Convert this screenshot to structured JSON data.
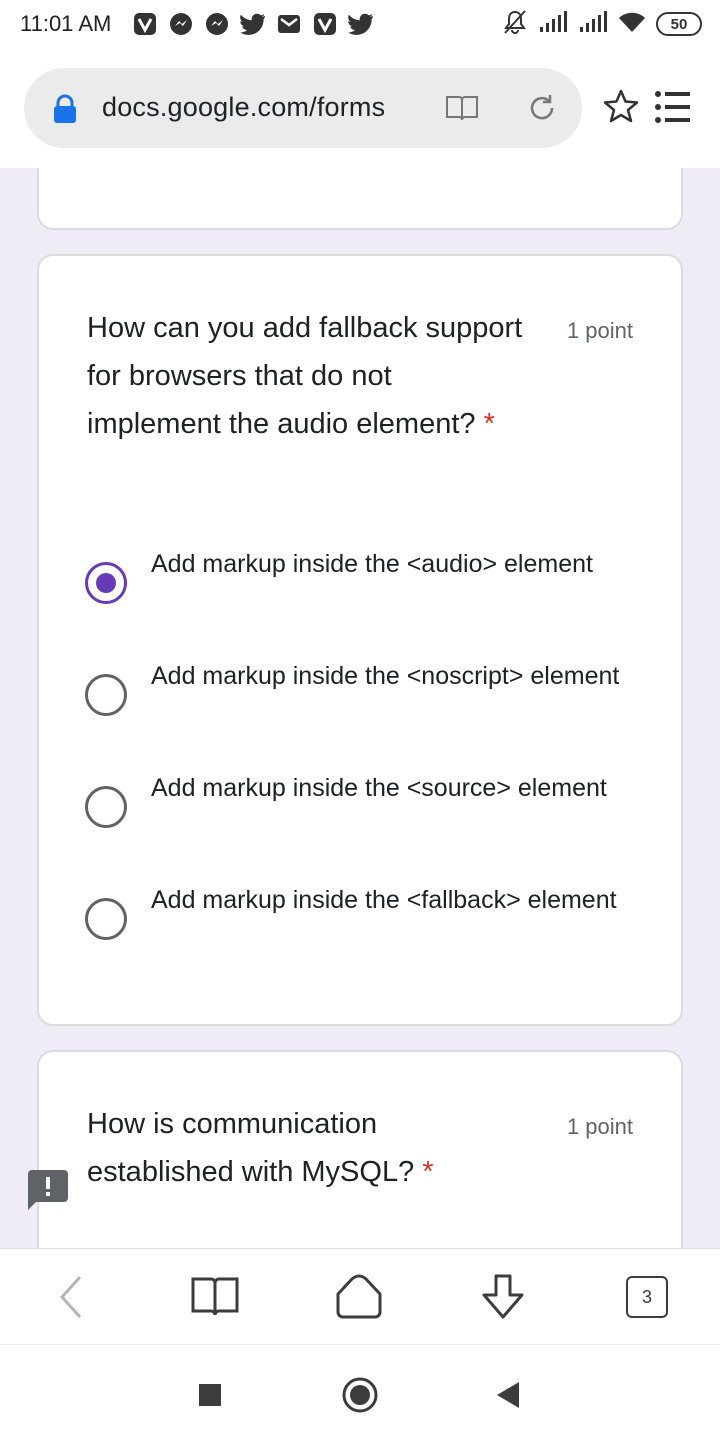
{
  "status_bar": {
    "time": "11:01 AM",
    "battery": "50",
    "app_icons": [
      "v-app-icon",
      "messenger-icon",
      "messenger-icon",
      "twitter-icon",
      "gmail-icon",
      "v-app-icon",
      "twitter-icon"
    ],
    "right_icons": [
      "mute-bell-icon",
      "signal-icon",
      "signal-icon",
      "wifi-icon"
    ]
  },
  "browser": {
    "url": "docs.google.com/forms"
  },
  "questions": [
    {
      "title": "How can you add fallback support for browsers that do not implement the audio element?",
      "required_mark": "*",
      "points": "1 point",
      "options": [
        {
          "label": "Add markup inside the <audio> element",
          "checked": true
        },
        {
          "label": "Add markup inside the <noscript> element",
          "checked": false
        },
        {
          "label": "Add markup inside the <source> element",
          "checked": false
        },
        {
          "label": "Add markup inside the <fallback> element",
          "checked": false
        }
      ]
    },
    {
      "title": "How is communication established with MySQL?",
      "required_mark": "*",
      "points": "1 point"
    }
  ],
  "bottom_nav": {
    "tab_count": "3"
  },
  "colors": {
    "accent": "#673ab7",
    "required": "#d93025",
    "form_background": "#efecf8",
    "lock": "#1a73e8"
  }
}
